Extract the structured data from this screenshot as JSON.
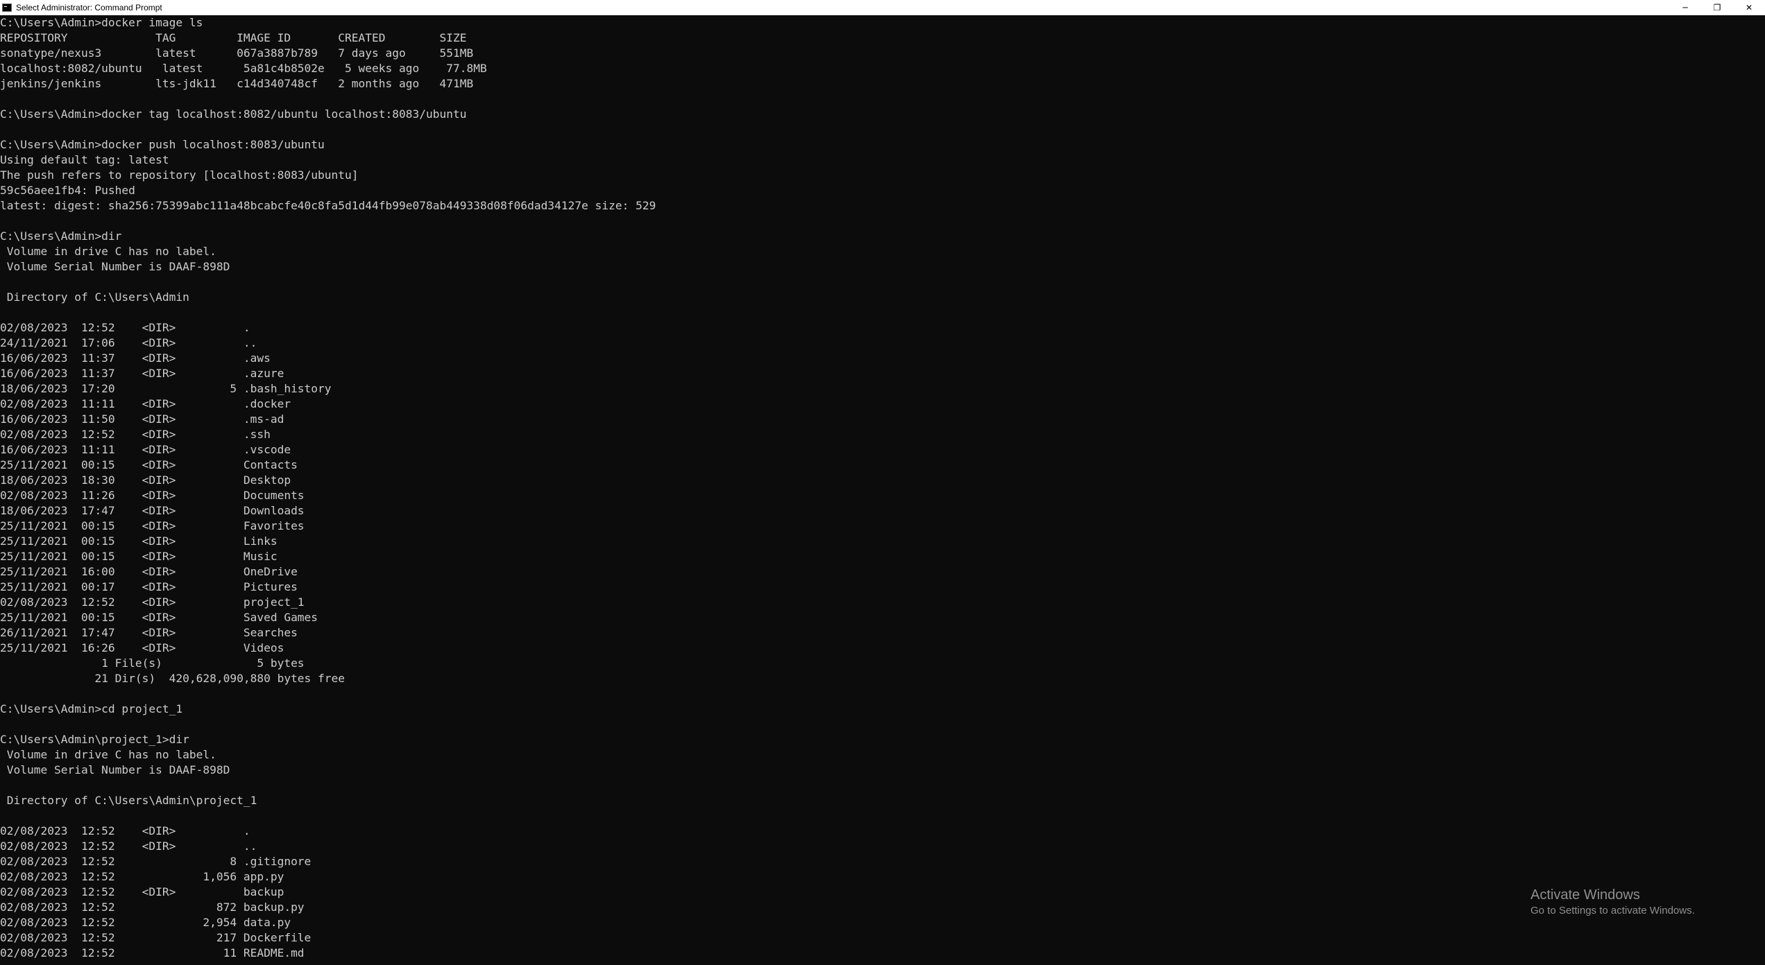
{
  "window": {
    "title": "Select Administrator: Command Prompt",
    "controls": [
      "─",
      "❐",
      "✕"
    ]
  },
  "terminal": {
    "lines": [
      "C:\\Users\\Admin>docker image ls",
      "REPOSITORY             TAG         IMAGE ID       CREATED        SIZE",
      "sonatype/nexus3        latest      067a3887b789   7 days ago     551MB",
      "localhost:8082/ubuntu   latest      5a81c4b8502e   5 weeks ago    77.8MB",
      "jenkins/jenkins        lts-jdk11   c14d340748cf   2 months ago   471MB",
      "",
      "C:\\Users\\Admin>docker tag localhost:8082/ubuntu localhost:8083/ubuntu",
      "",
      "C:\\Users\\Admin>docker push localhost:8083/ubuntu",
      "Using default tag: latest",
      "The push refers to repository [localhost:8083/ubuntu]",
      "59c56aee1fb4: Pushed",
      "latest: digest: sha256:75399abc111a48bcabcfe40c8fa5d1d44fb99e078ab449338d08f06dad34127e size: 529",
      "",
      "C:\\Users\\Admin>dir",
      " Volume in drive C has no label.",
      " Volume Serial Number is DAAF-898D",
      "",
      " Directory of C:\\Users\\Admin",
      "",
      "02/08/2023  12:52    <DIR>          .",
      "24/11/2021  17:06    <DIR>          ..",
      "16/06/2023  11:37    <DIR>          .aws",
      "16/06/2023  11:37    <DIR>          .azure",
      "18/06/2023  17:20                 5 .bash_history",
      "02/08/2023  11:11    <DIR>          .docker",
      "16/06/2023  11:50    <DIR>          .ms-ad",
      "02/08/2023  12:52    <DIR>          .ssh",
      "16/06/2023  11:11    <DIR>          .vscode",
      "25/11/2021  00:15    <DIR>          Contacts",
      "18/06/2023  18:30    <DIR>          Desktop",
      "02/08/2023  11:26    <DIR>          Documents",
      "18/06/2023  17:47    <DIR>          Downloads",
      "25/11/2021  00:15    <DIR>          Favorites",
      "25/11/2021  00:15    <DIR>          Links",
      "25/11/2021  00:15    <DIR>          Music",
      "25/11/2021  16:00    <DIR>          OneDrive",
      "25/11/2021  00:17    <DIR>          Pictures",
      "02/08/2023  12:52    <DIR>          project_1",
      "25/11/2021  00:15    <DIR>          Saved Games",
      "26/11/2021  17:47    <DIR>          Searches",
      "25/11/2021  16:26    <DIR>          Videos",
      "               1 File(s)              5 bytes",
      "              21 Dir(s)  420,628,090,880 bytes free",
      "",
      "C:\\Users\\Admin>cd project_1",
      "",
      "C:\\Users\\Admin\\project_1>dir",
      " Volume in drive C has no label.",
      " Volume Serial Number is DAAF-898D",
      "",
      " Directory of C:\\Users\\Admin\\project_1",
      "",
      "02/08/2023  12:52    <DIR>          .",
      "02/08/2023  12:52    <DIR>          ..",
      "02/08/2023  12:52                 8 .gitignore",
      "02/08/2023  12:52             1,056 app.py",
      "02/08/2023  12:52    <DIR>          backup",
      "02/08/2023  12:52               872 backup.py",
      "02/08/2023  12:52             2,954 data.py",
      "02/08/2023  12:52               217 Dockerfile",
      "02/08/2023  12:52                11 README.md"
    ]
  },
  "watermark": {
    "title": "Activate Windows",
    "subtitle": "Go to Settings to activate Windows."
  }
}
